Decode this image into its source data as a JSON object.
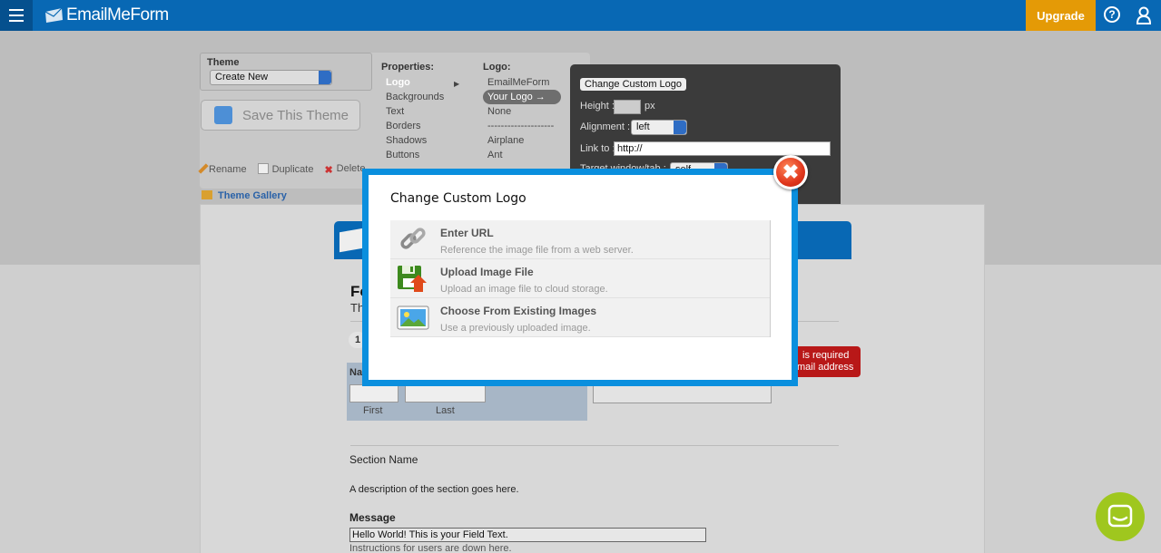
{
  "app": {
    "brand": "EmailMeForm",
    "upgrade_label": "Upgrade",
    "help_glyph": "?"
  },
  "theme_panel": {
    "theme_label": "Theme",
    "theme_select": "Create New",
    "save_button": "Save This Theme",
    "actions": [
      "Rename",
      "Duplicate",
      "Delete"
    ],
    "gallery_link": "Theme Gallery",
    "properties_label": "Properties:",
    "properties": [
      "Logo",
      "Backgrounds",
      "Text",
      "Borders",
      "Shadows",
      "Buttons"
    ],
    "logo_label": "Logo:",
    "logos": [
      "EmailMeForm",
      "Your Logo →",
      "None",
      "--------------------",
      "Airplane",
      "Ant"
    ]
  },
  "logo_popup": {
    "button": "Change Custom Logo",
    "height_label": "Height :",
    "height_unit": "px",
    "alignment_label": "Alignment :",
    "alignment_value": "left",
    "link_label": "Link to :",
    "link_value": "http://",
    "target_label": "Target window/tab :",
    "target_value": "self"
  },
  "form_preview": {
    "title_fragment": "Fo",
    "subtitle_fragment": "Th",
    "step": "1",
    "name_label": "Na",
    "first_caption": "First",
    "last_caption": "Last",
    "error_line1": "is required",
    "error_line2": "mail address",
    "section_name": "Section Name",
    "section_desc": "A description of the section goes here.",
    "message_label": "Message",
    "message_value": "Hello World!  This is your Field Text.",
    "message_hint": "Instructions for users are down here."
  },
  "modal": {
    "title": "Change Custom Logo",
    "options": [
      {
        "title": "Enter URL",
        "desc": "Reference the image file from a web server.",
        "icon": "link-chain-icon"
      },
      {
        "title": "Upload Image File",
        "desc": "Upload an image file to cloud storage.",
        "icon": "upload-disk-icon"
      },
      {
        "title": "Choose From Existing Images",
        "desc": "Use a previously uploaded image.",
        "icon": "image-picture-icon"
      }
    ]
  },
  "colors": {
    "topbar": "#0868b4",
    "upgrade": "#e49a06",
    "modal_border": "#0a8fde",
    "close": "#e0361c",
    "chat": "#9fc71e"
  }
}
